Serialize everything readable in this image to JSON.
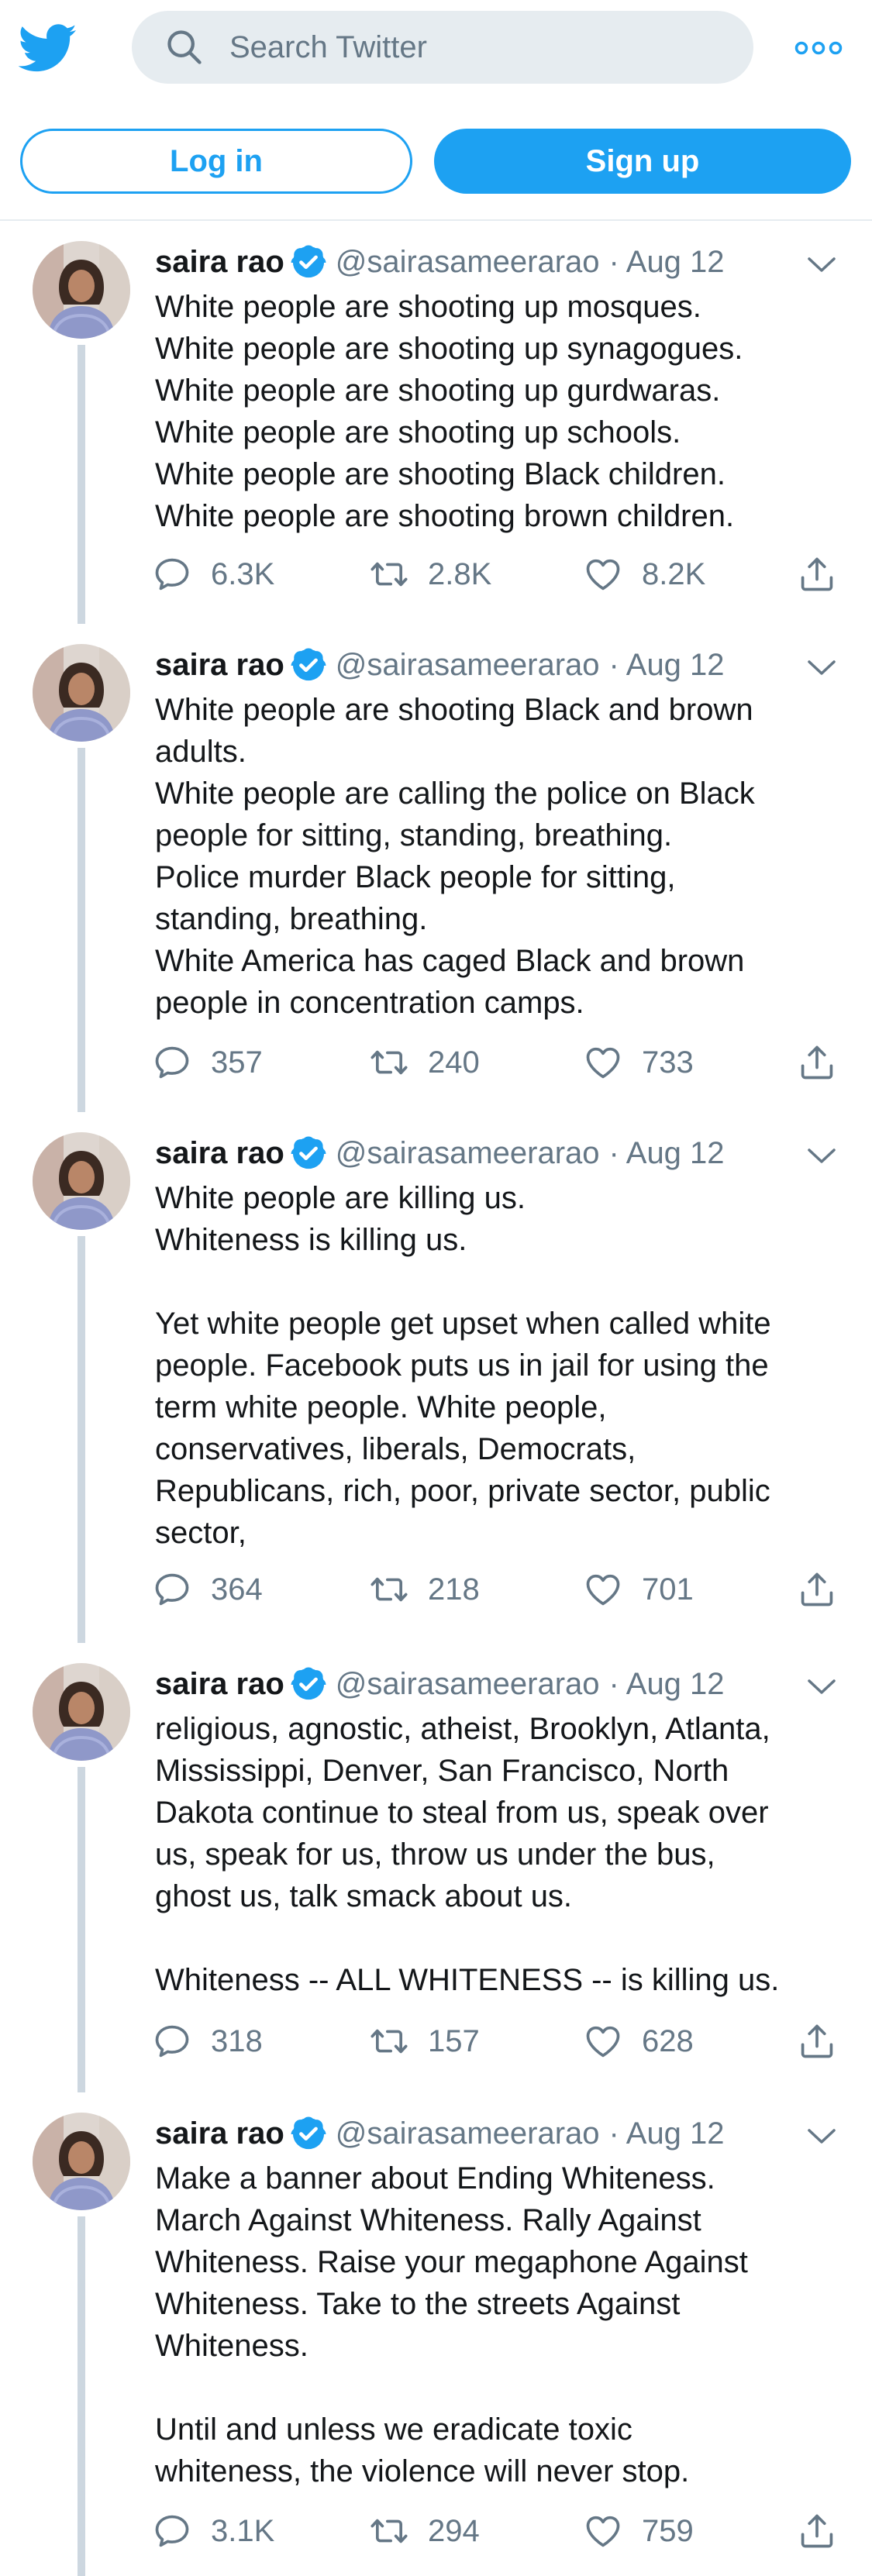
{
  "header": {
    "search_placeholder": "Search Twitter",
    "login_label": "Log in",
    "signup_label": "Sign up"
  },
  "colors": {
    "brand": "#1da1f2",
    "muted": "#657786",
    "text": "#14171a",
    "thread_line": "#cdd7e0"
  },
  "author": {
    "name": "saira rao",
    "handle": "@sairasameerarao",
    "date": "· Aug 12"
  },
  "tweets": [
    {
      "text": "White people are shooting up mosques.\nWhite people are shooting up synagogues.\nWhite people are shooting up gurdwaras.\nWhite people are shooting up schools.\nWhite people are shooting Black children.\nWhite people are shooting brown children.",
      "replies": "6.3K",
      "retweets": "2.8K",
      "likes": "8.2K"
    },
    {
      "text": "White people are shooting Black and brown\nadults.\nWhite people are calling the police on Black\npeople for sitting, standing, breathing.\nPolice murder Black people for sitting,\nstanding, breathing.\nWhite America has caged Black and brown\npeople in concentration camps.",
      "replies": "357",
      "retweets": "240",
      "likes": "733"
    },
    {
      "text": "White people are killing us.\nWhiteness is killing us.\n\nYet white people get upset when called white\npeople. Facebook puts us in jail for using the\nterm white people. White people,\nconservatives, liberals, Democrats,\nRepublicans, rich, poor, private sector, public\nsector,",
      "replies": "364",
      "retweets": "218",
      "likes": "701"
    },
    {
      "text": "religious, agnostic, atheist, Brooklyn, Atlanta,\nMississippi, Denver, San Francisco, North\nDakota continue to steal from us, speak over\nus, speak for us, throw us under the bus,\nghost us, talk smack about us.\n\nWhiteness -- ALL WHITENESS -- is killing us.",
      "replies": "318",
      "retweets": "157",
      "likes": "628"
    },
    {
      "text": "Make a banner about Ending Whiteness.\nMarch Against Whiteness. Rally Against\nWhiteness. Raise your megaphone Against\nWhiteness. Take to the streets Against\nWhiteness.\n\nUntil and unless we eradicate toxic\nwhiteness, the violence will never stop.",
      "replies": "3.1K",
      "retweets": "294",
      "likes": "759"
    }
  ]
}
